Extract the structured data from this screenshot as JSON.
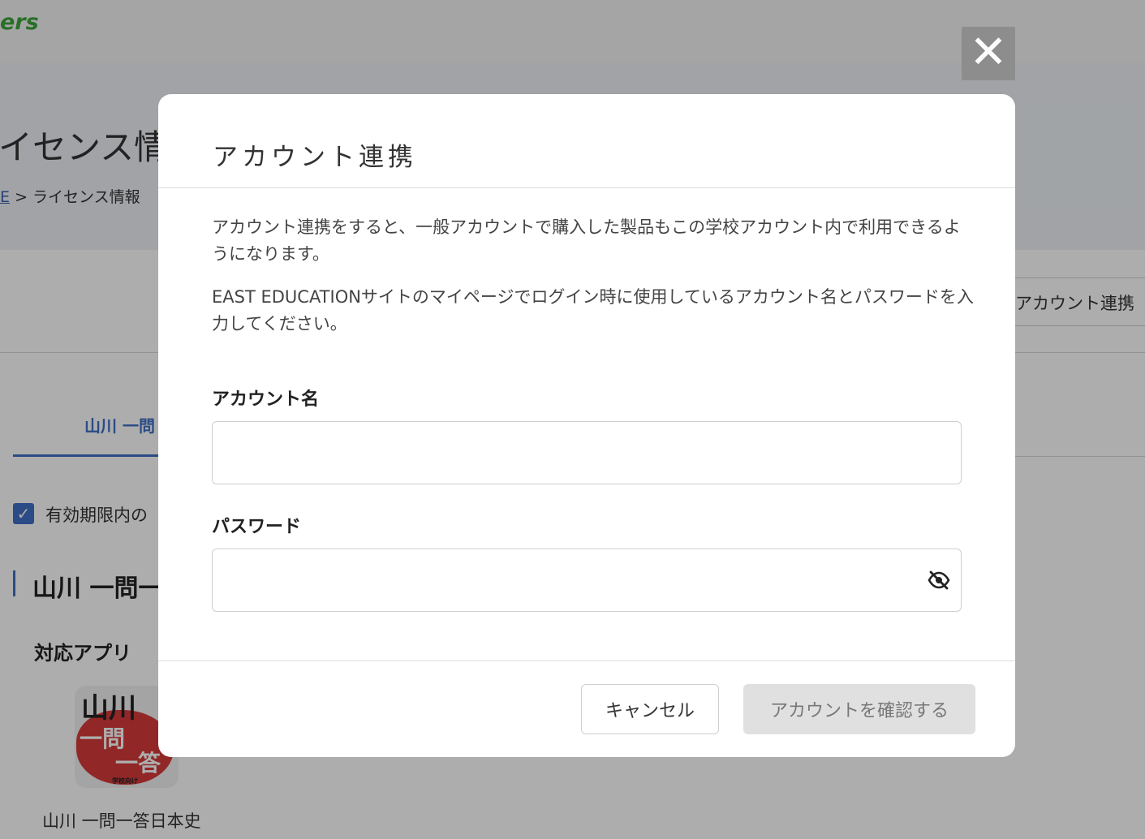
{
  "background": {
    "logo_text": "ers",
    "page_title": "イセンス情報",
    "breadcrumb": {
      "home": "E",
      "separator": ">",
      "current": "ライセンス情報"
    },
    "account_link_button": "アカウント連携",
    "tab_label": "山川 一問",
    "filter_checkbox": {
      "checked": true,
      "label": "有効期限内の"
    },
    "section_title": "山川 一問一",
    "apps_label": "対応アプリ",
    "app_icon": {
      "line1": "山川",
      "line2": "一問",
      "line3": "一答",
      "line4": "学校向け"
    },
    "app_name": "山川 一問一答日本史"
  },
  "overlay": {
    "close_symbol": "✕"
  },
  "modal": {
    "title": "アカウント連携",
    "description_1": "アカウント連携をすると、一般アカウントで購入した製品もこの学校アカウント内で利用できるようになります。",
    "description_2": "EAST EDUCATIONサイトのマイページでログイン時に使用しているアカウント名とパスワードを入力してください。",
    "account_label": "アカウント名",
    "account_value": "",
    "password_label": "パスワード",
    "password_value": "",
    "password_visibility_icon": "eye-off-icon",
    "cancel_label": "キャンセル",
    "confirm_label": "アカウントを確認する",
    "confirm_enabled": false
  }
}
